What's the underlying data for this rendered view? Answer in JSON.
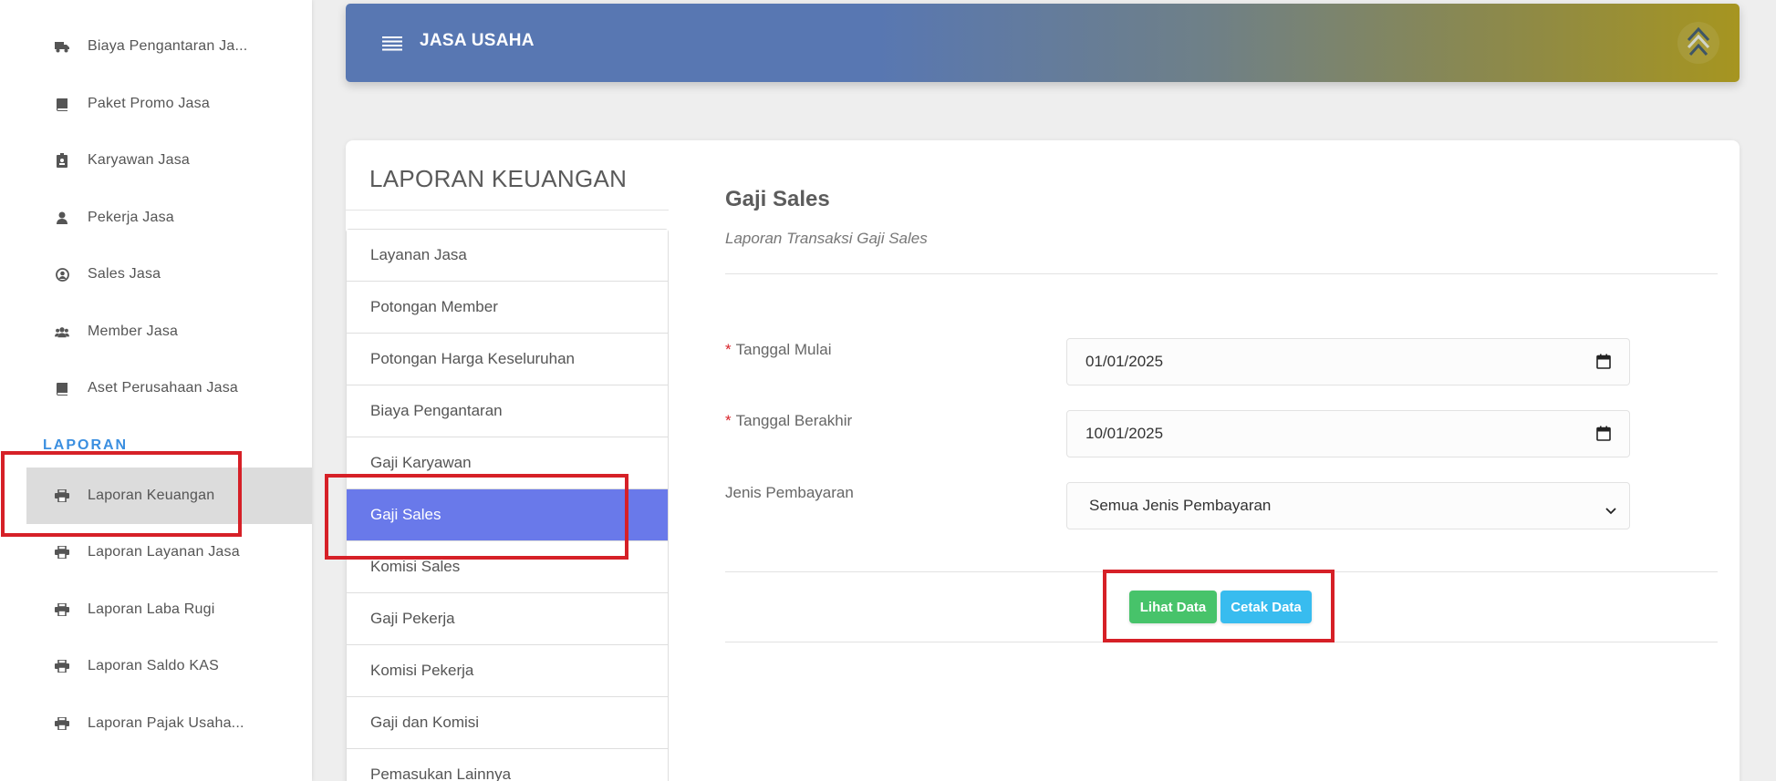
{
  "sidebar": {
    "items": [
      {
        "label": "Biaya Pengantaran Ja...",
        "icon": "truck-icon"
      },
      {
        "label": "Paket Promo Jasa",
        "icon": "book-icon"
      },
      {
        "label": "Karyawan Jasa",
        "icon": "id-badge-icon"
      },
      {
        "label": "Pekerja Jasa",
        "icon": "user-icon"
      },
      {
        "label": "Sales Jasa",
        "icon": "user-circle-icon"
      },
      {
        "label": "Member Jasa",
        "icon": "users-icon"
      },
      {
        "label": "Aset Perusahaan Jasa",
        "icon": "book-icon"
      }
    ],
    "section_heading": "LAPORAN",
    "report_items": [
      {
        "label": "Laporan Keuangan",
        "icon": "printer-icon",
        "active": true
      },
      {
        "label": "Laporan Layanan Jasa",
        "icon": "printer-icon"
      },
      {
        "label": "Laporan Laba Rugi",
        "icon": "printer-icon"
      },
      {
        "label": "Laporan Saldo KAS",
        "icon": "printer-icon"
      },
      {
        "label": "Laporan Pajak Usaha...",
        "icon": "printer-icon"
      }
    ]
  },
  "header": {
    "title": "JASA USAHA",
    "menu_icon": "hamburger-menu-icon",
    "logo_icon": "company-logo-icon"
  },
  "card": {
    "title": "LAPORAN KEUANGAN",
    "menu": [
      "Layanan Jasa",
      "Potongan Member",
      "Potongan Harga Keseluruhan",
      "Biaya Pengantaran",
      "Gaji Karyawan",
      "Gaji Sales",
      "Komisi Sales",
      "Gaji Pekerja",
      "Komisi Pekerja",
      "Gaji dan Komisi",
      "Pemasukan Lainnya"
    ],
    "active_menu": "Gaji Sales"
  },
  "content": {
    "title": "Gaji Sales",
    "subtitle": "Laporan Transaksi Gaji Sales",
    "required_mark": "*",
    "fields": {
      "start_date": {
        "label": "Tanggal Mulai",
        "value": "01/01/2025"
      },
      "end_date": {
        "label": "Tanggal Berakhir",
        "value": "10/01/2025"
      },
      "payment_type": {
        "label": "Jenis Pembayaran",
        "value": "Semua Jenis Pembayaran"
      }
    },
    "buttons": {
      "view": "Lihat Data",
      "print": "Cetak Data"
    }
  },
  "colors": {
    "highlight_box": "#d62027",
    "active_menu": "#6979ea",
    "view_button": "#47c36a",
    "print_button": "#38bcef",
    "section_heading": "#3b8fe0"
  }
}
